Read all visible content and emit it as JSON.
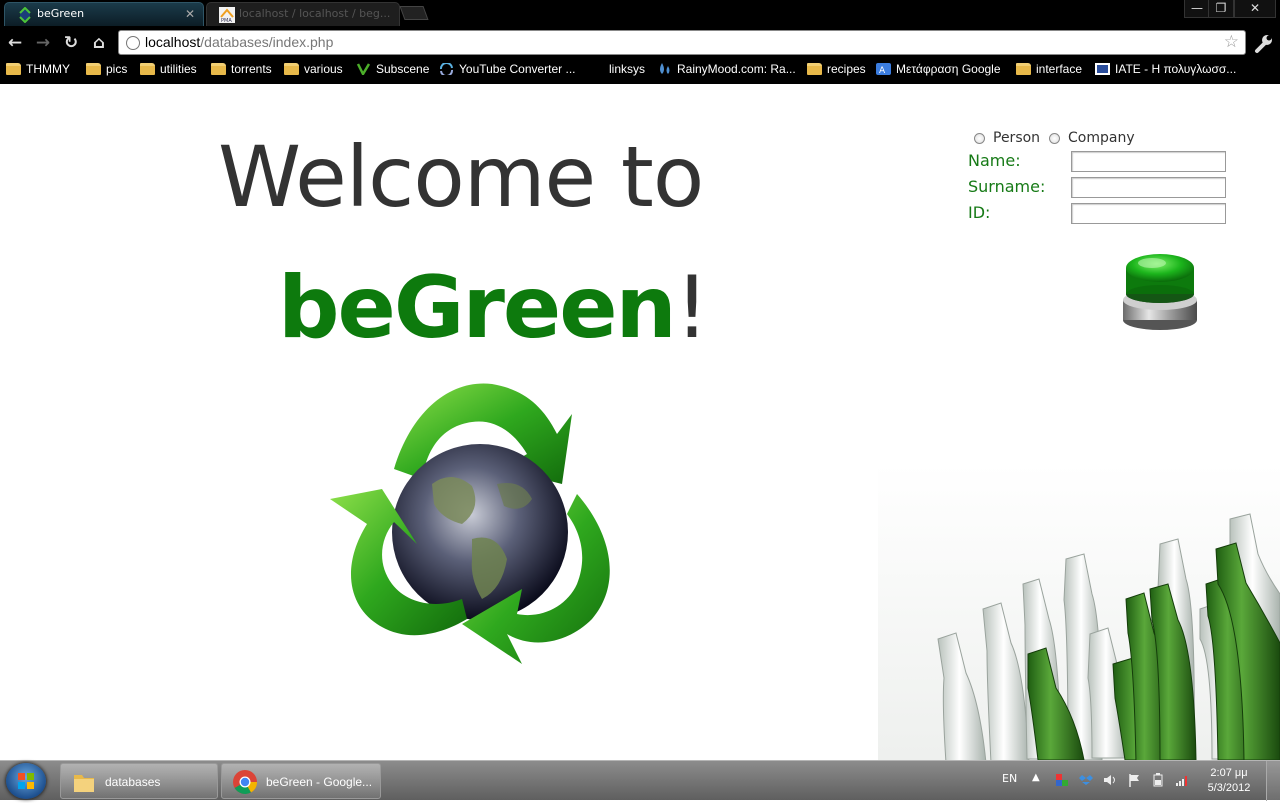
{
  "browser": {
    "tabs": [
      {
        "title": "beGreen",
        "active": true
      },
      {
        "title": "localhost / localhost / beg...",
        "active": false
      }
    ],
    "url_host": "localhost",
    "url_path": "/databases/index.php",
    "nav": {
      "back": "←",
      "forward": "→",
      "reload": "↻",
      "home": "⌂"
    },
    "window_buttons": {
      "minimize": "—",
      "maximize": "❐",
      "close": "✕"
    },
    "bookmarks": [
      {
        "label": "THMMY",
        "icon": "folder-icon"
      },
      {
        "label": "pics",
        "icon": "folder-icon"
      },
      {
        "label": "utilities",
        "icon": "folder-icon"
      },
      {
        "label": "torrents",
        "icon": "folder-icon"
      },
      {
        "label": "various",
        "icon": "folder-icon"
      },
      {
        "label": "Subscene",
        "icon": "subscene-icon"
      },
      {
        "label": "YouTube Converter ...",
        "icon": "converter-icon"
      },
      {
        "label": "linksys",
        "icon": "none"
      },
      {
        "label": "RainyMood.com: Ra...",
        "icon": "raindrop-icon"
      },
      {
        "label": "recipes",
        "icon": "folder-icon"
      },
      {
        "label": "Μετάφραση Google",
        "icon": "translate-icon"
      },
      {
        "label": "interface",
        "icon": "folder-icon"
      },
      {
        "label": "IATE - Η πολυγλωσσ...",
        "icon": "iate-icon"
      }
    ]
  },
  "page": {
    "welcome": "Welcome to",
    "brand": "beGreen",
    "brand_suffix": "!",
    "form": {
      "type_options": [
        "Person",
        "Company"
      ],
      "fields": [
        {
          "label": "Name:",
          "value": ""
        },
        {
          "label": "Surname:",
          "value": ""
        },
        {
          "label": "ID:",
          "value": ""
        }
      ]
    },
    "colors": {
      "brand": "#0d7a0d",
      "label": "#167a16",
      "text": "#333333"
    }
  },
  "taskbar": {
    "tasks": [
      {
        "label": "databases",
        "icon": "folder-icon"
      },
      {
        "label": "beGreen - Google...",
        "icon": "chrome-icon"
      }
    ],
    "language": "EN",
    "time": "2:07 μμ",
    "date": "5/3/2012"
  }
}
